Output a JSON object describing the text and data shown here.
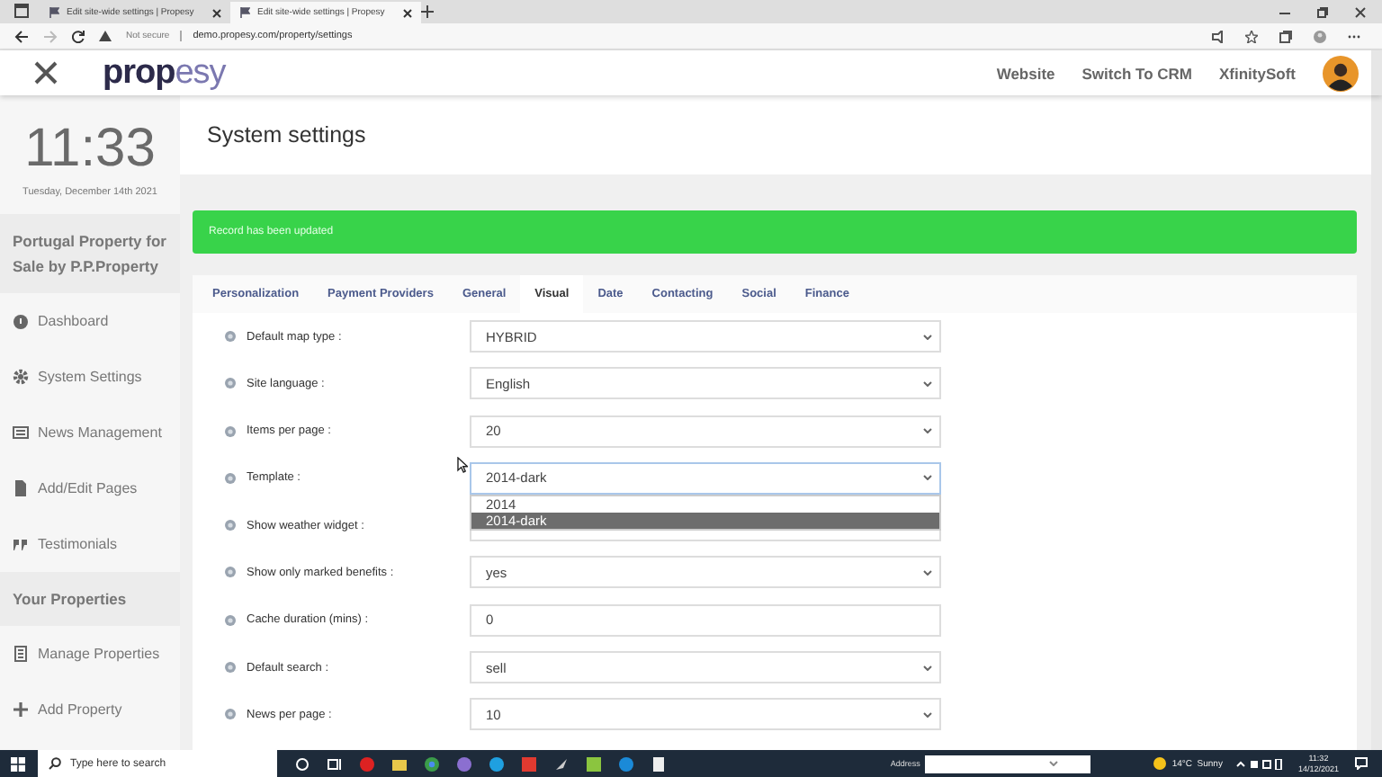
{
  "browser": {
    "tabs": [
      {
        "title": "Edit site-wide settings | Propesy",
        "selected": false
      },
      {
        "title": "Edit site-wide settings | Propesy",
        "selected": true
      }
    ],
    "security": "Not secure",
    "address": "demo.propesy.com/property/settings"
  },
  "header": {
    "logo_dark": "prop",
    "logo_light": "esy",
    "links": [
      "Website",
      "Switch To CRM"
    ],
    "user": "XfinitySoft"
  },
  "sidebar": {
    "clock": "11:33",
    "date": "Tuesday, December 14th 2021",
    "items": [
      {
        "kind": "heading",
        "label": "Portugal Property for Sale by P.P.Property"
      },
      {
        "kind": "item",
        "label": "Dashboard"
      },
      {
        "kind": "item",
        "label": "System Settings"
      },
      {
        "kind": "item",
        "label": "News Management"
      },
      {
        "kind": "item",
        "label": "Add/Edit Pages"
      },
      {
        "kind": "item",
        "label": "Testimonials"
      },
      {
        "kind": "heading",
        "label": "Your Properties"
      },
      {
        "kind": "item",
        "label": "Manage Properties"
      },
      {
        "kind": "item",
        "label": "Add Property"
      }
    ]
  },
  "page_title": "System settings",
  "alert": "Record has been updated",
  "tabs": [
    {
      "label": "Personalization",
      "selected": false
    },
    {
      "label": "Payment Providers",
      "selected": false
    },
    {
      "label": "General",
      "selected": false
    },
    {
      "label": "Visual",
      "selected": true
    },
    {
      "label": "Date",
      "selected": false
    },
    {
      "label": "Contacting",
      "selected": false
    },
    {
      "label": "Social",
      "selected": false
    },
    {
      "label": "Finance",
      "selected": false
    }
  ],
  "settings": [
    {
      "label": "Default map type :",
      "kind": "select",
      "value": "HYBRID",
      "expanded": false
    },
    {
      "label": "Site language :",
      "kind": "select",
      "value": "English",
      "expanded": false
    },
    {
      "label": "Items per page :",
      "kind": "select",
      "value": "20",
      "expanded": false
    },
    {
      "label": "Template :",
      "kind": "select",
      "value": "2014-dark",
      "expanded": true,
      "options": [
        {
          "label": "2014",
          "selected": false
        },
        {
          "label": "2014-dark",
          "selected": true
        }
      ]
    },
    {
      "label": "Show weather widget :",
      "kind": "select",
      "expanded": false
    },
    {
      "label": "Show only marked benefits :",
      "kind": "select",
      "value": "yes",
      "expanded": false
    },
    {
      "label": "Cache duration (mins) :",
      "kind": "input",
      "value": "0"
    },
    {
      "label": "Default search :",
      "kind": "select",
      "value": "sell",
      "expanded": false
    },
    {
      "label": "News per page :",
      "kind": "select",
      "value": "10",
      "expanded": false
    }
  ],
  "taskbar": {
    "search_placeholder": "Type here to search",
    "address_label": "Address",
    "weather": "14°C  Sunny",
    "time": "11:32",
    "date": "14/12/2021"
  }
}
